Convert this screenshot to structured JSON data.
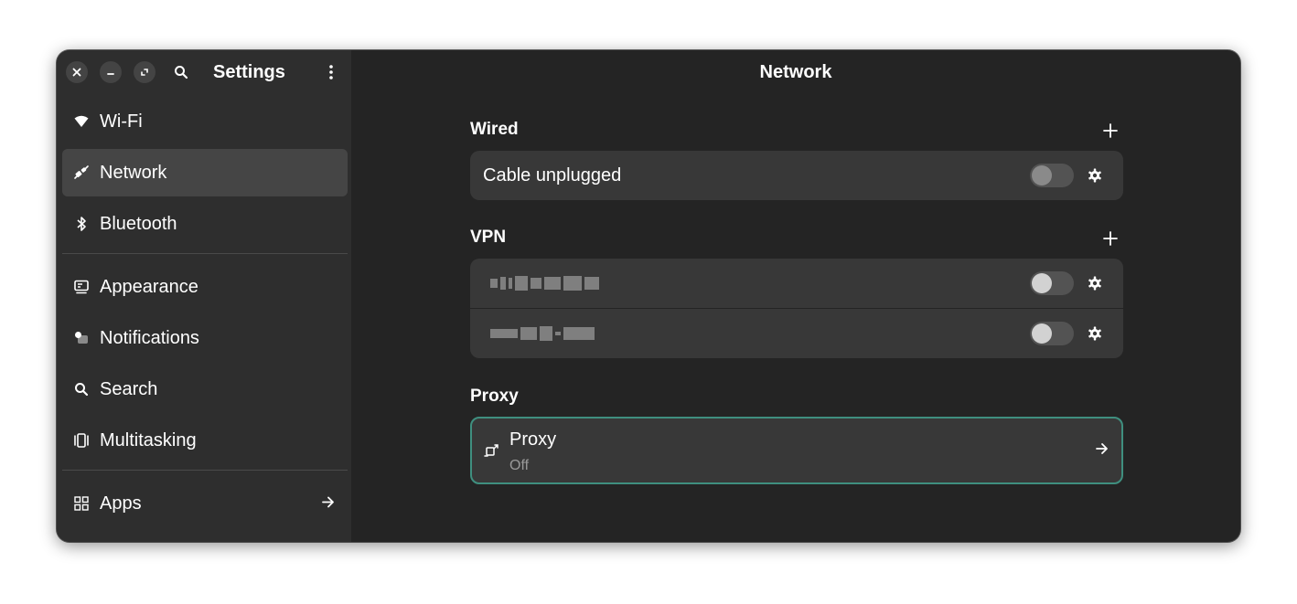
{
  "window": {
    "controls": [
      "close-icon",
      "minimize-icon",
      "maximize-icon"
    ]
  },
  "sidebar": {
    "title": "Settings",
    "items": [
      {
        "label": "Wi-Fi",
        "icon": "wifi-icon"
      },
      {
        "label": "Network",
        "icon": "network-icon",
        "active": true
      },
      {
        "label": "Bluetooth",
        "icon": "bluetooth-icon"
      },
      {
        "label": "Appearance",
        "icon": "appearance-icon"
      },
      {
        "label": "Notifications",
        "icon": "notifications-icon"
      },
      {
        "label": "Search",
        "icon": "search-icon"
      },
      {
        "label": "Multitasking",
        "icon": "multitasking-icon"
      },
      {
        "label": "Apps",
        "icon": "apps-icon"
      }
    ]
  },
  "main": {
    "title": "Network",
    "wired": {
      "title": "Wired",
      "rows": [
        {
          "label": "Cable unplugged",
          "enabled": false
        }
      ]
    },
    "vpn": {
      "title": "VPN",
      "rows": [
        {
          "label": "",
          "enabled": false
        },
        {
          "label": "",
          "enabled": false
        }
      ]
    },
    "proxy": {
      "title": "Proxy",
      "row_title": "Proxy",
      "row_status": "Off"
    }
  },
  "colors": {
    "window_bg": "#242424",
    "sidebar_bg": "#2e2e2e",
    "card_bg": "#383838",
    "focus_border": "#3f8f7f",
    "active_item": "#454545"
  }
}
